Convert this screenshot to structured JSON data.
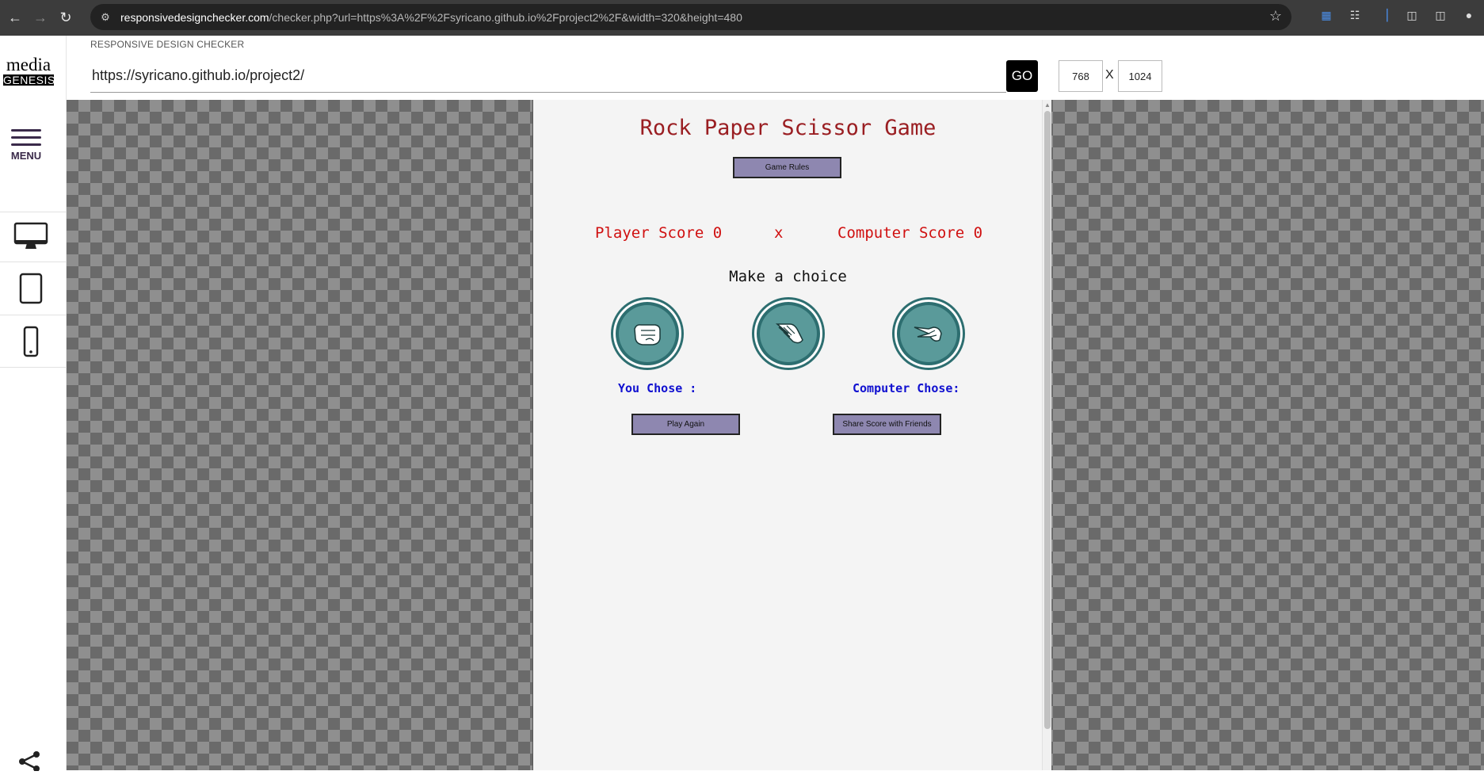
{
  "browser": {
    "url_host": "responsivedesignchecker.com",
    "url_rest": "/checker.php?url=https%3A%2F%2Fsyricano.github.io%2Fproject2%2F&width=320&height=480"
  },
  "sidebar": {
    "logo_top": "media",
    "logo_bottom": "GENESIS",
    "menu_label": "MENU"
  },
  "header": {
    "title": "RESPONSIVE DESIGN CHECKER",
    "url_value": "https://syricano.github.io/project2/",
    "go_label": "GO",
    "width_value": "768",
    "x_label": "X",
    "height_value": "1024"
  },
  "game": {
    "title": "Rock Paper Scissor Game",
    "rules_button": "Game Rules",
    "player_score_label": "Player Score 0",
    "versus": "x",
    "computer_score_label": "Computer Score 0",
    "prompt": "Make a choice",
    "choices": [
      "rock",
      "paper",
      "scissors"
    ],
    "you_chose_label": "You Chose :",
    "computer_chose_label": "Computer Chose:",
    "play_again_button": "Play Again",
    "share_button": "Share Score with Friends"
  },
  "colors": {
    "title": "#9a1e22",
    "score": "#d01010",
    "chose": "#1010d0",
    "button_bg": "#8e87b0",
    "choice_bg": "#2d6e70"
  }
}
